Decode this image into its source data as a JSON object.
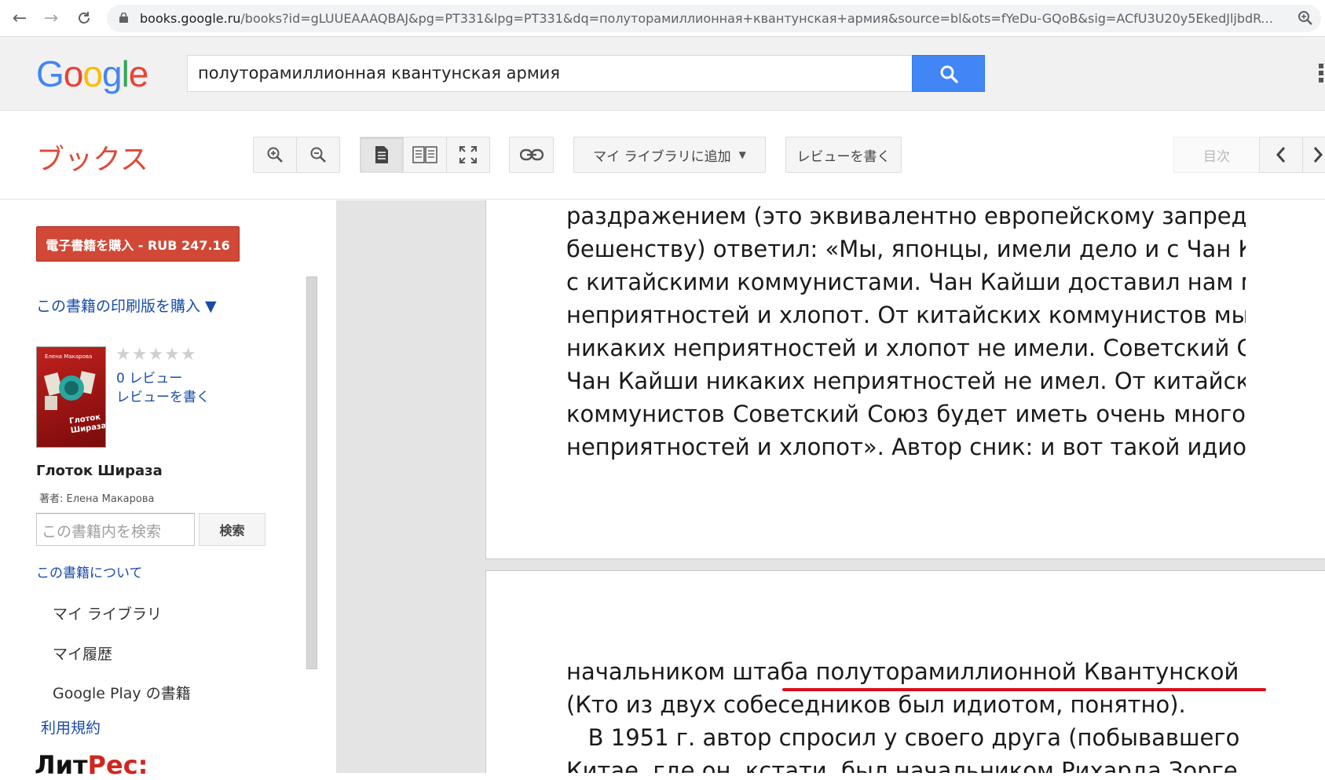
{
  "browser": {
    "url_host": "books.google.ru",
    "url_rest": "/books?id=gLUUEAAAQBAJ&pg=PT331&lpg=PT331&dq=полуторамиллионная+квантунская+армия&source=bl&ots=fYeDu-GQoB&sig=ACfU3U20y5EkedJljbdRTsDRGC..."
  },
  "header": {
    "logo_letters": [
      "G",
      "o",
      "o",
      "g",
      "l",
      "e"
    ],
    "logo_colors": [
      "#4285f4",
      "#ea4335",
      "#fbbc05",
      "#4285f4",
      "#34a853",
      "#ea4335"
    ],
    "search_query": "полуторамиллионная квантунская армия"
  },
  "toolbar": {
    "books_title": "ブックス",
    "add_to_library_label": "マイ ライブラリに追加",
    "write_review_label": "レビューを書く",
    "contents_label": "目次"
  },
  "sidebar": {
    "buy_ebook_label": "電子書籍を購入 - RUB 247.16",
    "buy_print_label": "この書籍の印刷版を購入 ▼",
    "cover_author": "Елена Макарова",
    "cover_title": "Глоток Шираза",
    "stars": "★★★★★",
    "review_count": "0 レビュー",
    "write_review": "レビューを書く",
    "book_title": "Глоток Шираза",
    "book_author": "著者: Елена Макарова",
    "in_book_search_placeholder": "この書籍内を検索",
    "in_book_search_button": "検索",
    "about_book": "この書籍について",
    "menu": [
      "マイ ライブラリ",
      "マイ履歴",
      "Google Play の書籍"
    ],
    "terms": "利用規約",
    "brand_dark": "Лит",
    "brand_red": "Рес:"
  },
  "book": {
    "page1_lines": [
      "раздражением (это эквивалентно европейскому запредельному",
      "бешенству) ответил: «Мы, японцы, имели дело и с Чан Кайши, и",
      "с китайскими коммунистами. Чан Кайши доставил нам много",
      "неприятностей и хлопот. От китайских коммунистов мы",
      "никаких неприятностей и хлопот не имели. Советский Союз от",
      "Чан Кайши никаких неприятностей не имел. От китайских",
      "коммунистов Советский Союз будет иметь очень много",
      "неприятностей и хлопот». Автор сник: и вот такой идиот был"
    ],
    "page2_lines": [
      "начальником штаба полуторамиллионной Квантунской армии!!",
      "(Кто из двух собеседников был идиотом, понятно).",
      "   В 1951 г. автор спросил у своего друга (побывавшего в",
      "Китае, где он, кстати, был начальником Рихарда Зорге. Рихард"
    ]
  }
}
